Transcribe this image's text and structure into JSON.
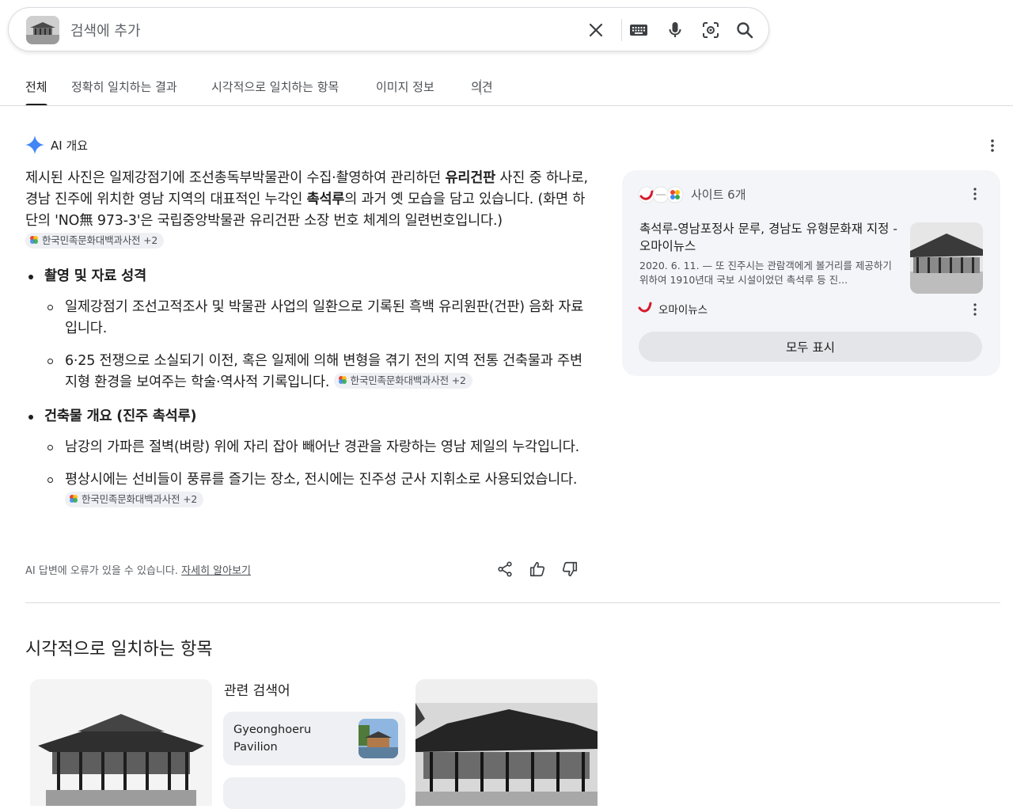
{
  "search": {
    "placeholder": "검색에 추가",
    "icons": [
      "close-icon",
      "keyboard-icon",
      "microphone-icon",
      "lens-icon",
      "search-icon"
    ]
  },
  "tabs": [
    {
      "label": "전체",
      "active": true
    },
    {
      "label": "정확히 일치하는 결과",
      "active": false
    },
    {
      "label": "시각적으로 일치하는 항목",
      "active": false
    },
    {
      "label": "이미지 정보",
      "active": false
    },
    {
      "label": "의견",
      "active": false
    }
  ],
  "ai_overview": {
    "label": "AI 개요",
    "intro": {
      "t1": "제시된 사진은 일제강점기에 조선총독부박물관이 수집·촬영하여 관리하던 ",
      "b1": "유리건판",
      "t2": " 사진 중 하나로, 경남 진주에 위치한 영남 지역의 대표적인 누각인 ",
      "b2": "촉석루",
      "t3": "의 과거 옛 모습을 담고 있습니다. (화면 하단의 'NO無 973-3'은 국립중앙박물관 유리건판 소장 번호 체계의 일련번호입니다.)"
    },
    "source_chip": "한국민족문화대백과사전 +2",
    "sections": [
      {
        "heading": "촬영 및 자료 성격",
        "items": [
          "일제강점기 조선고적조사 및 박물관 사업의 일환으로 기록된 흑백 유리원판(건판) 음화 자료입니다.",
          "6·25 전쟁으로 소실되기 이전, 혹은 일제에 의해 변형을 겪기 전의 지역 전통 건축물과 주변 지형 환경을 보여주는 학술·역사적 기록입니다."
        ]
      },
      {
        "heading": "건축물 개요 (진주 촉석루)",
        "items": [
          "남강의 가파른 절벽(벼랑) 위에 자리 잡아 빼어난 경관을 자랑하는 영남 제일의 누각입니다.",
          "평상시에는 선비들이 풍류를 즐기는 장소, 전시에는 진주성 군사 지휘소로 사용되었습니다."
        ]
      }
    ],
    "disclaimer": "AI 답변에 오류가 있을 수 있습니다.",
    "learn_more": "자세히 알아보기"
  },
  "side_card": {
    "sites_label": "사이트 6개",
    "article": {
      "title": "촉석루-영남포정사 문루, 경남도 유형문화재 지정 - 오마이뉴스",
      "snippet": "2020. 6. 11. — 또 진주시는 관람객에게 볼거리를 제공하기 위하여 1910년대 국보 시설이었던 촉석루 등 진..."
    },
    "source_name": "오마이뉴스",
    "show_all": "모두 표시"
  },
  "visual_matches": {
    "title": "시각적으로 일치하는 항목",
    "related_title": "관련 검색어",
    "related_item": "Gyeonghoeru Pavilion"
  },
  "colors": {
    "text": "#1f1f1f",
    "muted": "#4d5156",
    "gemini_blue": "#4285f4",
    "card_bg": "#f3f5f8",
    "ohmynews_red": "#d51a2a"
  }
}
